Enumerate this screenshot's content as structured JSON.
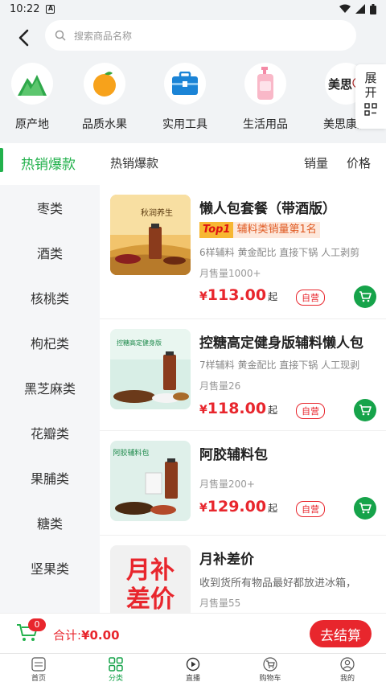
{
  "statusbar": {
    "time": "10:22",
    "notif_glyph": "A"
  },
  "search": {
    "placeholder": "搜索商品名称"
  },
  "top_categories": [
    {
      "label": "原产地",
      "icon": "mountain-icon"
    },
    {
      "label": "品质水果",
      "icon": "orange-icon"
    },
    {
      "label": "实用工具",
      "icon": "toolbox-icon"
    },
    {
      "label": "生活用品",
      "icon": "lotion-bottle-icon"
    },
    {
      "label": "美思康宸",
      "icon": "brand-logo-icon"
    }
  ],
  "expand": {
    "char1": "展",
    "char2": "开"
  },
  "filter": {
    "active_tab": "热销爆款",
    "second_tab": "热销爆款",
    "sort_sales": "销量",
    "sort_price": "价格"
  },
  "sidebar": {
    "items": [
      "枣类",
      "酒类",
      "核桃类",
      "枸杞类",
      "黑芝麻类",
      "花瓣类",
      "果脯类",
      "糖类",
      "坚果类"
    ]
  },
  "products": [
    {
      "title": "懒人包套餐（带酒版）",
      "top_badge": "Top1",
      "rank_text": "辅料类销量第1名",
      "desc": "6样辅料 黄金配比 直接下锅 人工剥剪",
      "sales": "月售量1000+",
      "price_symbol": "¥",
      "price": "113.00",
      "price_suffix": "起",
      "tag": "自营",
      "thumb_text": "秋润养生"
    },
    {
      "title": "控糖高定健身版辅料懒人包",
      "desc": "7样辅料 黄金配比 直接下锅 人工现剥",
      "sales": "月售量26",
      "price_symbol": "¥",
      "price": "118.00",
      "price_suffix": "起",
      "tag": "自营",
      "thumb_text": "控糖高定健身版"
    },
    {
      "title": "阿胶辅料包",
      "sales": "月售量200+",
      "price_symbol": "¥",
      "price": "129.00",
      "price_suffix": "起",
      "tag": "自营",
      "thumb_text": "阿胶辅料包"
    },
    {
      "title": "月补差价",
      "desc": "收到货所有物品最好都放进冰箱，",
      "sales": "月售量55",
      "thumb_line1": "月补",
      "thumb_line2": "差价"
    }
  ],
  "cartbar": {
    "count": "0",
    "total_label": "合计:",
    "total_value": "¥0.00",
    "checkout": "去结算"
  },
  "bottomnav": [
    {
      "label": "首页",
      "icon": "home-logo-icon"
    },
    {
      "label": "分类",
      "icon": "category-grid-icon"
    },
    {
      "label": "直播",
      "icon": "play-circle-icon"
    },
    {
      "label": "购物车",
      "icon": "shopping-cart-icon"
    },
    {
      "label": "我的",
      "icon": "user-icon"
    }
  ],
  "colors": {
    "accent_green": "#22b14c",
    "price_red": "#e8262d",
    "header_bg": "#f1f3f5"
  }
}
